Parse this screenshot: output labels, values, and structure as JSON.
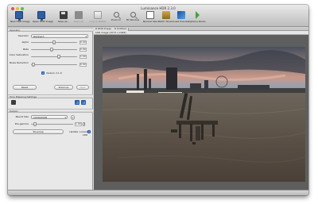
{
  "window": {
    "title": "Luminance HDR 2.3.0"
  },
  "toolbar": {
    "buttons": [
      {
        "label": "New HDR Image",
        "icon": "monitor-icon",
        "enabled": true
      },
      {
        "label": "Open HDR Image",
        "icon": "monitor-icon",
        "enabled": true
      },
      {
        "label": "Save as...",
        "icon": "disk-icon",
        "enabled": true
      },
      {
        "label": "Save All",
        "icon": "disk-icon",
        "enabled": false
      },
      {
        "label": "Crop & Rotate",
        "icon": "crop-icon",
        "enabled": false
      },
      {
        "label": "Zoom In",
        "icon": "zoom-in-icon",
        "enabled": true
      },
      {
        "label": "Fit Window",
        "icon": "fit-window-icon",
        "enabled": true
      },
      {
        "label": "Normal Size",
        "icon": "normal-size-icon",
        "enabled": true
      },
      {
        "label": "Batch Tonem.",
        "icon": "batch-icon",
        "enabled": true
      },
      {
        "label": "Load Preview",
        "icon": "tonemap-icon",
        "enabled": true
      },
      {
        "label": "Options Rocks",
        "icon": "play-icon",
        "enabled": true
      }
    ]
  },
  "operator_panel": {
    "section_title": "Operator",
    "operator_label": "Operator",
    "operator_value": "Reinhard",
    "sliders": [
      {
        "label": "Alpha",
        "value": "0.00",
        "fraction": 0.5
      },
      {
        "label": "Beta",
        "value": "0.90",
        "fraction": 0.45
      },
      {
        "label": "Color Saturation",
        "value": "1.00",
        "fraction": 0.6
      },
      {
        "label": "Noise Reduction",
        "value": "0.00",
        "fraction": 0.05
      }
    ],
    "version_checkbox_label": "Version 2.1.0",
    "version_checked": true,
    "buttons": {
      "reset": "Reset",
      "previous": "Previous",
      "next": "Next"
    }
  },
  "tone_mapping_settings": {
    "section_title": "Tone Mapping Settings"
  },
  "output_panel": {
    "section_title": "Output",
    "result_size_label": "Result Size",
    "result_size_value": "1024x2048",
    "pre_gamma_label": "Pre-gamma",
    "pre_gamma_value": "1.00",
    "pre_gamma_fraction": 0.1,
    "tonemap_button": "Tonemap",
    "update_ldr_label": "Update current LDR",
    "update_ldr_checked": true
  },
  "content": {
    "tabs": [
      "HDR Image",
      "Untitled"
    ],
    "image_header": "LDR image (1072 x 2048)"
  },
  "colors": {
    "accent_blue": "#3b7de0",
    "panel_bg": "#e8e8e8",
    "content_bg": "#5e5e5e"
  }
}
